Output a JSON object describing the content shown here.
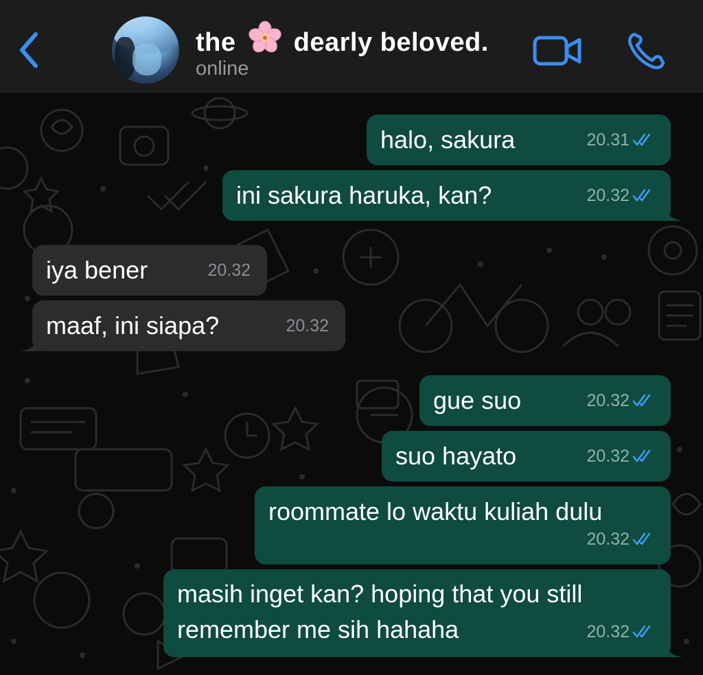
{
  "header": {
    "name_part1": "the",
    "name_part2": "dearly beloved.",
    "status": "online"
  },
  "colors": {
    "accent": "#3b8ef0",
    "outgoing_bubble": "#0f4b3f",
    "incoming_bubble": "#2c2c2e",
    "read_ticks": "#3b9df5"
  },
  "icons": [
    "back-chevron-icon",
    "cherry-blossom-emoji",
    "video-call-icon",
    "phone-call-icon",
    "double-check-icon"
  ],
  "messages": [
    {
      "direction": "out",
      "text": "halo, sakura",
      "time": "20.31",
      "status": "read"
    },
    {
      "direction": "out",
      "text": "ini sakura haruka, kan?",
      "time": "20.32",
      "status": "read"
    },
    {
      "direction": "in",
      "text": "iya bener",
      "time": "20.32"
    },
    {
      "direction": "in",
      "text": "maaf, ini siapa?",
      "time": "20.32"
    },
    {
      "direction": "out",
      "text": "gue suo",
      "time": "20.32",
      "status": "read"
    },
    {
      "direction": "out",
      "text": "suo hayato",
      "time": "20.32",
      "status": "read"
    },
    {
      "direction": "out",
      "text": "roommate lo waktu kuliah dulu",
      "time": "20.32",
      "status": "read"
    },
    {
      "direction": "out",
      "text": "masih inget kan? hoping that you still remember me sih hahaha",
      "time": "20.32",
      "status": "read"
    }
  ]
}
